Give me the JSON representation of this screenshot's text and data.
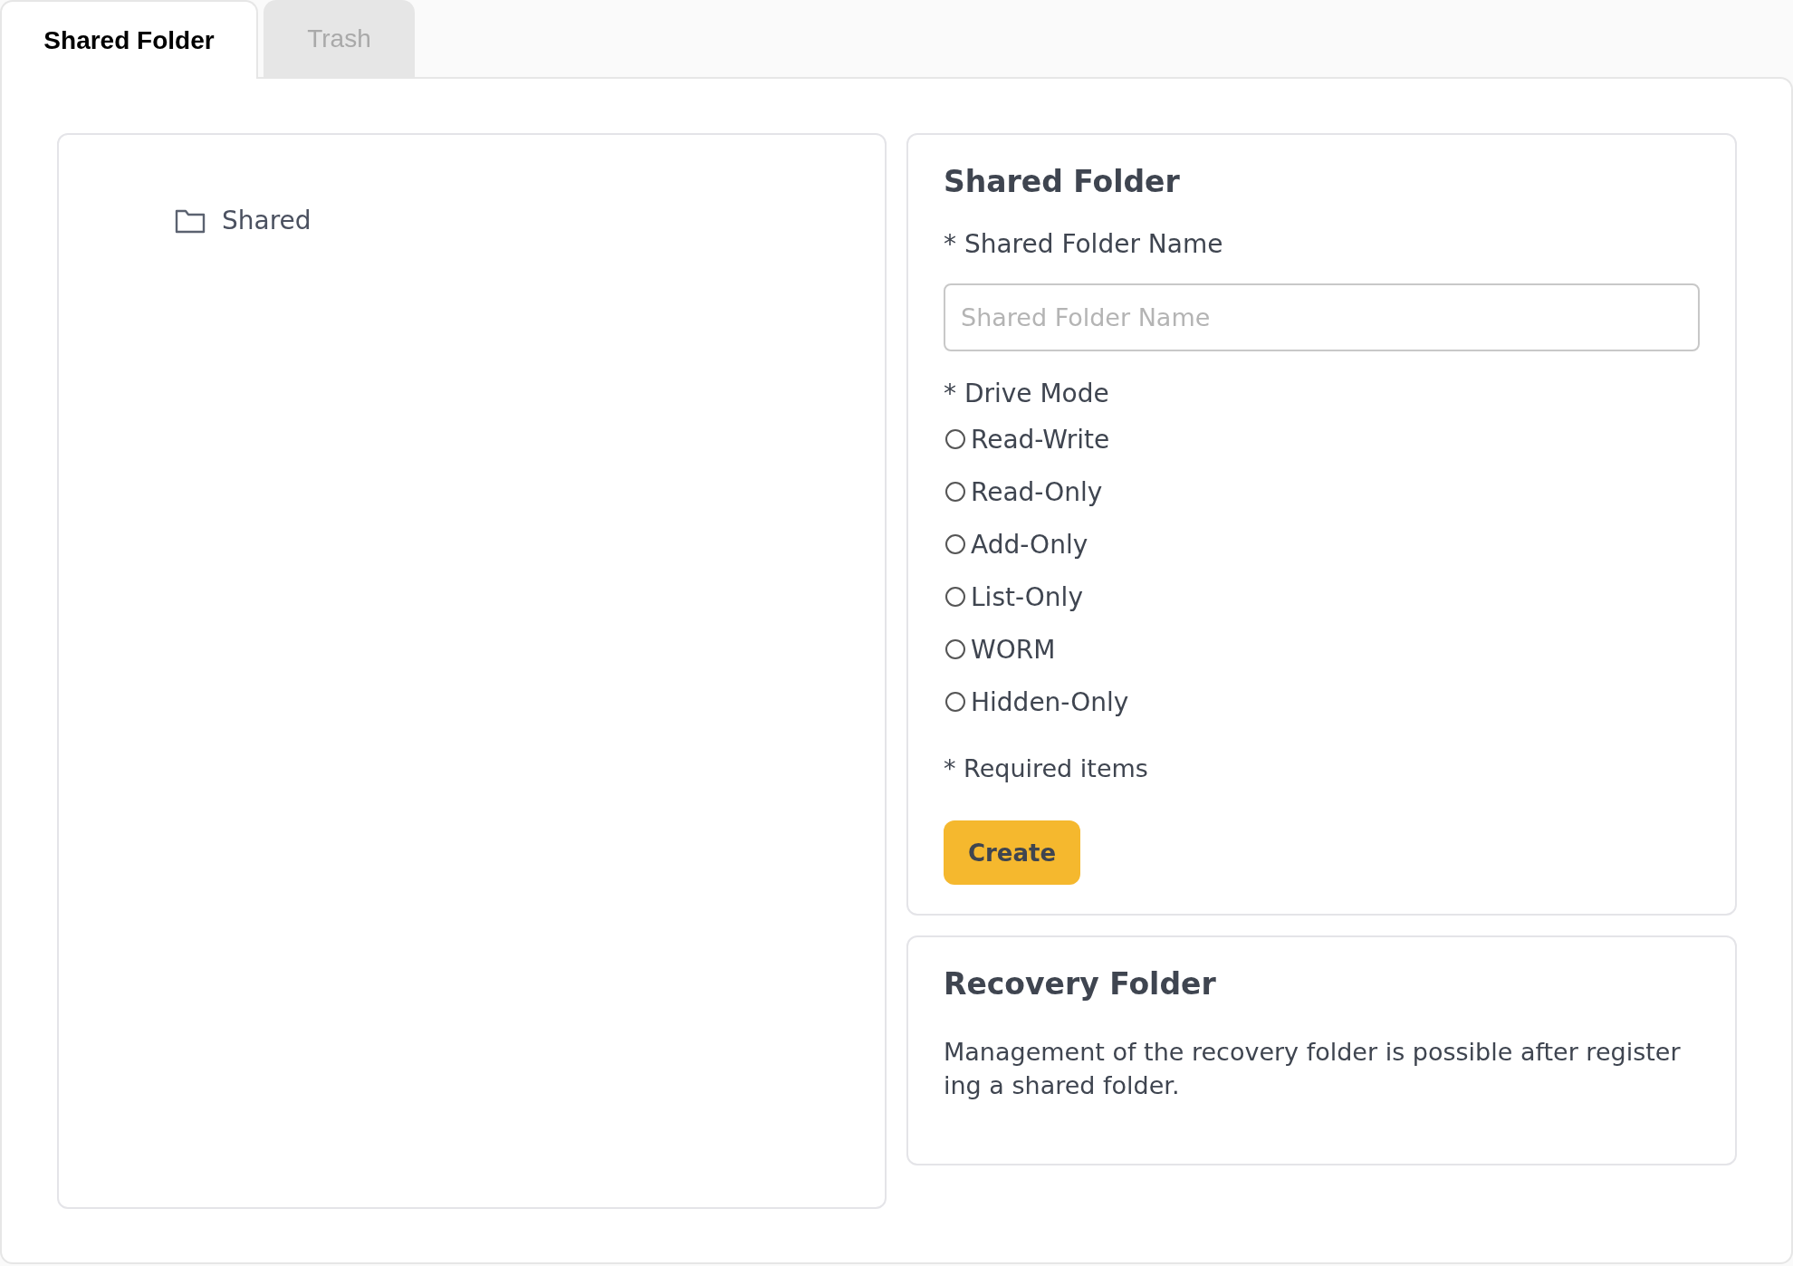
{
  "tabs": [
    {
      "label": "Shared Folder",
      "selected": true
    },
    {
      "label": "Trash",
      "selected": false
    }
  ],
  "folder_tree": {
    "items": [
      {
        "label": "Shared"
      }
    ]
  },
  "shared_folder_form": {
    "title": "Shared Folder",
    "name_label": "* Shared Folder Name",
    "name_field": {
      "placeholder": "Shared Folder Name"
    },
    "mode_label": "* Drive Mode",
    "modes": [
      {
        "label": "Read-Write",
        "selected": false
      },
      {
        "label": "Read-Only",
        "selected": false
      },
      {
        "label": "Add-Only",
        "selected": false
      },
      {
        "label": "List-Only",
        "selected": false
      },
      {
        "label": "WORM",
        "selected": false
      },
      {
        "label": "Hidden-Only",
        "selected": false
      }
    ],
    "required_note": "* Required items",
    "create_button": "Create"
  },
  "recovery_folder": {
    "title": "Recovery Folder",
    "message": "Management of the recovery folder is possible after registering a shared folder."
  }
}
